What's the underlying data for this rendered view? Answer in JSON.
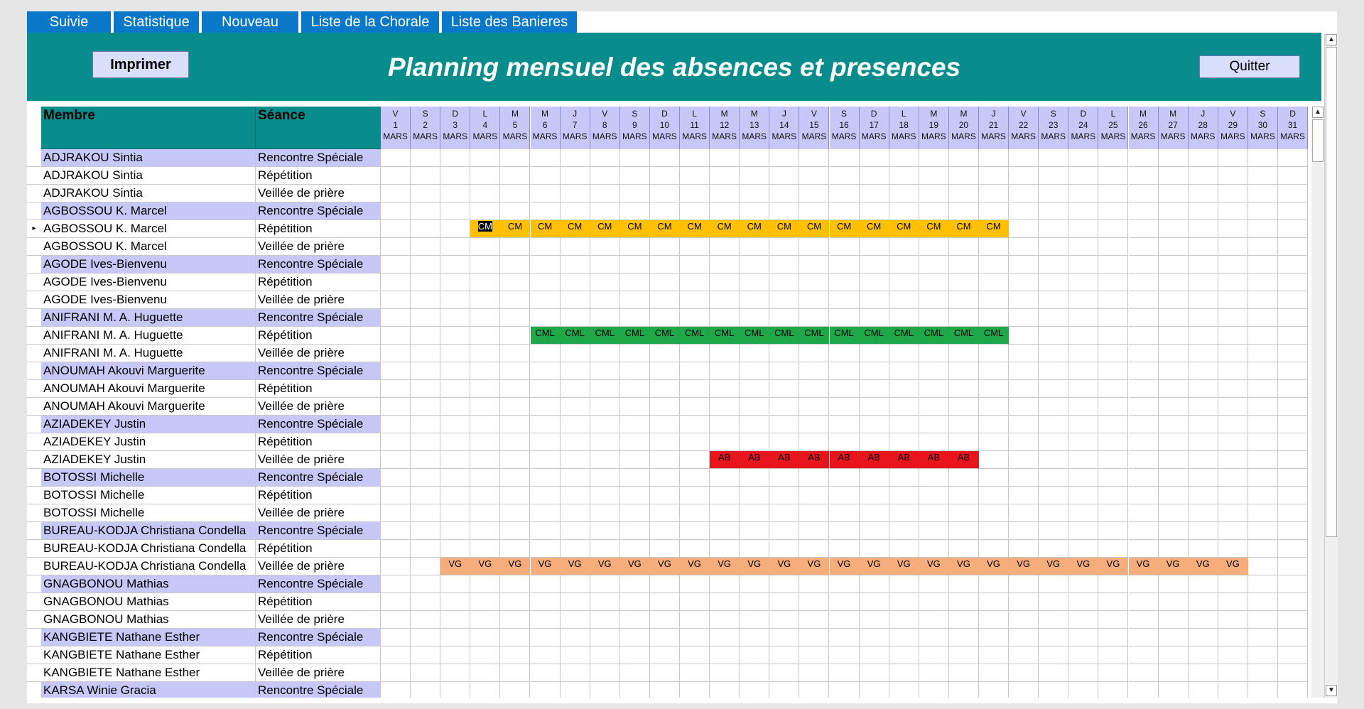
{
  "tabs": [
    "Suivie",
    "Statistique",
    "Nouveau",
    "Liste de la Chorale",
    "Liste des Banieres"
  ],
  "header": {
    "title": "Planning mensuel des absences et presences",
    "print_label": "Imprimer",
    "quit_label": "Quitter"
  },
  "columns": {
    "member": "Membre",
    "session": "Séance"
  },
  "days": {
    "month": "MARS",
    "letters": [
      "V",
      "S",
      "D",
      "L",
      "M",
      "M",
      "J",
      "V",
      "S",
      "D",
      "L",
      "M",
      "M",
      "J",
      "V",
      "S",
      "D",
      "L",
      "M",
      "M",
      "J",
      "V",
      "S",
      "D",
      "L",
      "M",
      "M",
      "J",
      "V",
      "S",
      "D"
    ],
    "numbers": [
      "1",
      "2",
      "3",
      "4",
      "5",
      "6",
      "7",
      "8",
      "9",
      "10",
      "11",
      "12",
      "13",
      "14",
      "15",
      "16",
      "17",
      "18",
      "19",
      "20",
      "21",
      "22",
      "23",
      "24",
      "25",
      "26",
      "27",
      "28",
      "29",
      "30",
      "31"
    ]
  },
  "rows": [
    {
      "member": "ADJRAKOU Sintia",
      "session": "Rencontre Spéciale"
    },
    {
      "member": "ADJRAKOU Sintia",
      "session": "Répétition"
    },
    {
      "member": "ADJRAKOU Sintia",
      "session": "Veillée de prière"
    },
    {
      "member": "AGBOSSOU K. Marcel",
      "session": "Rencontre Spéciale"
    },
    {
      "member": "AGBOSSOU K. Marcel",
      "session": "Répétition"
    },
    {
      "member": "AGBOSSOU K. Marcel",
      "session": "Veillée de prière"
    },
    {
      "member": "AGODE Ives-Bienvenu",
      "session": "Rencontre Spéciale"
    },
    {
      "member": "AGODE Ives-Bienvenu",
      "session": "Répétition"
    },
    {
      "member": "AGODE Ives-Bienvenu",
      "session": "Veillée de prière"
    },
    {
      "member": "ANIFRANI M. A. Huguette",
      "session": "Rencontre Spéciale"
    },
    {
      "member": "ANIFRANI M. A. Huguette",
      "session": "Répétition"
    },
    {
      "member": "ANIFRANI M. A. Huguette",
      "session": "Veillée de prière"
    },
    {
      "member": "ANOUMAH Akouvi Marguerite",
      "session": "Rencontre Spéciale"
    },
    {
      "member": "ANOUMAH Akouvi Marguerite",
      "session": "Répétition"
    },
    {
      "member": "ANOUMAH Akouvi Marguerite",
      "session": "Veillée de prière"
    },
    {
      "member": "AZIADEKEY Justin",
      "session": "Rencontre Spéciale"
    },
    {
      "member": "AZIADEKEY Justin",
      "session": "Répétition"
    },
    {
      "member": "AZIADEKEY Justin",
      "session": "Veillée de prière"
    },
    {
      "member": "BOTOSSI Michelle",
      "session": "Rencontre Spéciale"
    },
    {
      "member": "BOTOSSI Michelle",
      "session": "Répétition"
    },
    {
      "member": "BOTOSSI Michelle",
      "session": "Veillée de prière"
    },
    {
      "member": "BUREAU-KODJA Christiana Condella",
      "session": "Rencontre Spéciale"
    },
    {
      "member": "BUREAU-KODJA Christiana Condella",
      "session": "Répétition"
    },
    {
      "member": "BUREAU-KODJA Christiana Condella",
      "session": "Veillée de prière"
    },
    {
      "member": "GNAGBONOU Mathias",
      "session": "Rencontre Spéciale"
    },
    {
      "member": "GNAGBONOU Mathias",
      "session": "Répétition"
    },
    {
      "member": "GNAGBONOU Mathias",
      "session": "Veillée de prière"
    },
    {
      "member": "KANGBIETE Nathane Esther",
      "session": "Rencontre Spéciale"
    },
    {
      "member": "KANGBIETE Nathane Esther",
      "session": "Répétition"
    },
    {
      "member": "KANGBIETE Nathane Esther",
      "session": "Veillée de prière"
    },
    {
      "member": "KARSA Winie Gracia",
      "session": "Rencontre Spéciale"
    }
  ],
  "marks": [
    {
      "row": 4,
      "code": "CM",
      "from": 4,
      "to": 21,
      "color": "#ffc000",
      "highlight_first": true
    },
    {
      "row": 10,
      "code": "CML",
      "from": 6,
      "to": 21,
      "color": "#1fa84a"
    },
    {
      "row": 17,
      "code": "AB",
      "from": 12,
      "to": 20,
      "color": "#e8161c"
    },
    {
      "row": 23,
      "code": "VG",
      "from": 3,
      "to": 29,
      "color": "#f5ad7c"
    }
  ],
  "colors": {
    "tab": "#0a78c8",
    "header": "#088c8c",
    "special_row": "#c8c8f8",
    "column_header": "#088c8c"
  }
}
